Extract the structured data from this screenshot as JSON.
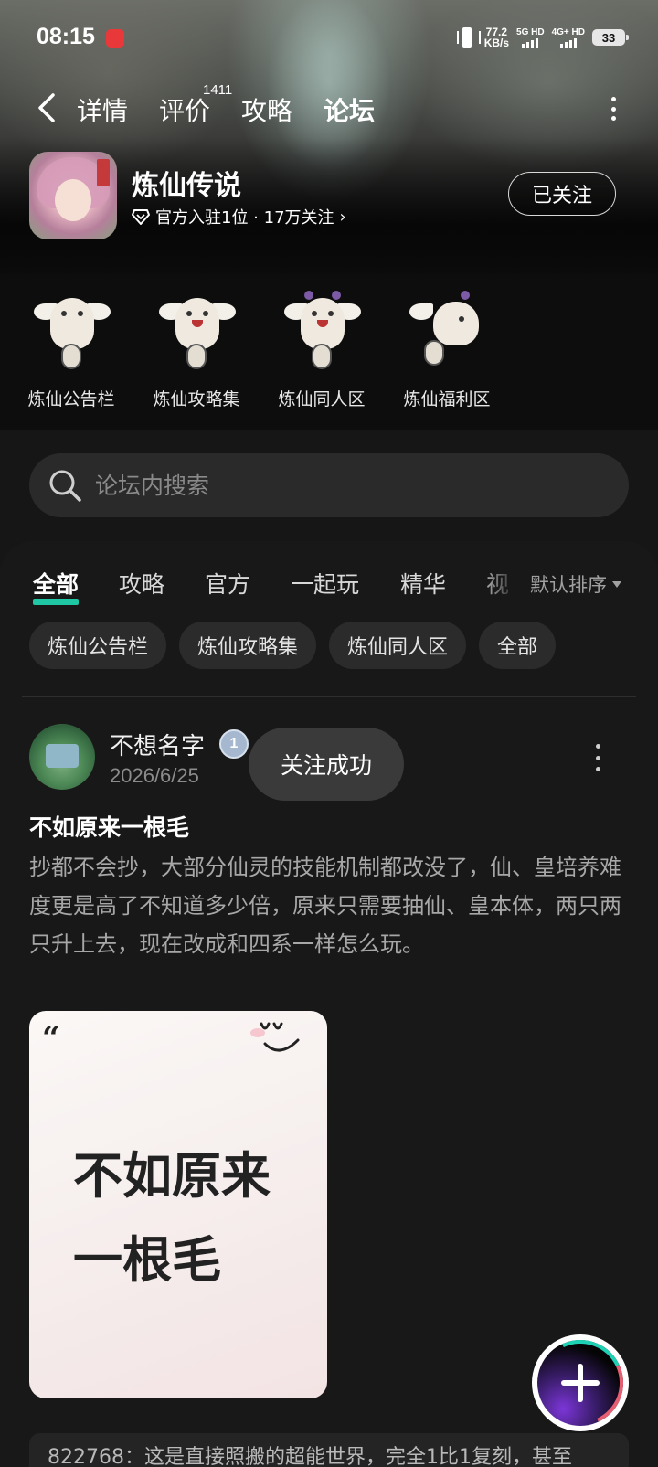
{
  "status_bar": {
    "time": "08:15",
    "net_speed_value": "77.2",
    "net_speed_unit": "KB/s",
    "sim1_label": "5G HD",
    "sim2_label": "4G+ HD",
    "battery": "33"
  },
  "nav": {
    "tabs": [
      {
        "label": "详情"
      },
      {
        "label": "评价"
      },
      {
        "label": "攻略"
      },
      {
        "label": "论坛"
      }
    ],
    "review_count": "1411",
    "active_tab": "论坛"
  },
  "game": {
    "name": "炼仙传说",
    "meta": "官方入驻1位 · 17万关注",
    "follow_label": "已关注"
  },
  "shortcuts": [
    {
      "label": "炼仙公告栏"
    },
    {
      "label": "炼仙攻略集"
    },
    {
      "label": "炼仙同人区"
    },
    {
      "label": "炼仙福利区"
    }
  ],
  "search": {
    "placeholder": "论坛内搜索"
  },
  "category_tabs": [
    {
      "label": "全部"
    },
    {
      "label": "攻略"
    },
    {
      "label": "官方"
    },
    {
      "label": "一起玩"
    },
    {
      "label": "精华"
    },
    {
      "label": "视"
    }
  ],
  "sort_label": "默认排序",
  "chips": [
    {
      "label": "炼仙公告栏"
    },
    {
      "label": "炼仙攻略集"
    },
    {
      "label": "炼仙同人区"
    },
    {
      "label": "全部"
    }
  ],
  "post": {
    "author": "不想名字",
    "level": "1",
    "date": "2026/6/25",
    "title": "不如原来一根毛",
    "body": "抄都不会抄，大部分仙灵的技能机制都改没了，仙、皇培养难度更是高了不知道多少倍，原来只需要抽仙、皇本体，两只两只升上去，现在改成和四系一样怎么玩。",
    "image_quote": "“",
    "image_line1": "不如原来",
    "image_line2": "一根毛"
  },
  "toast": "关注成功",
  "comment_preview": "822768：这是直接照搬的超能世界，完全1比1复刻，甚至",
  "colors": {
    "accent": "#1fc7a4",
    "background": "#161616"
  }
}
